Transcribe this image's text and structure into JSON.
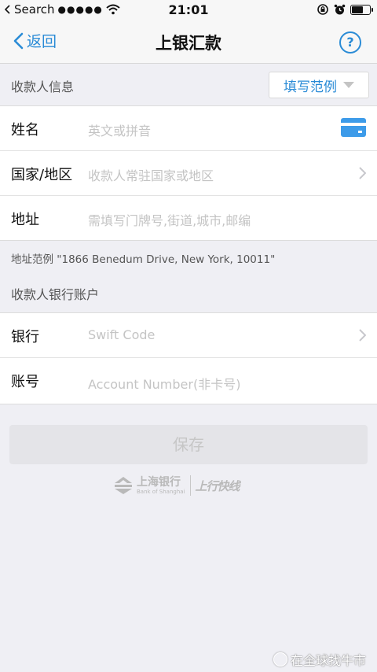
{
  "status_bar": {
    "carrier": "Search",
    "signal": "●●●●●",
    "time": "21:01",
    "battery_level": 0.65
  },
  "nav": {
    "back_label": "返回",
    "title": "上银汇款",
    "help_label": "?"
  },
  "payee_section": {
    "title": "收款人信息",
    "example_button": "填写范例"
  },
  "payee_fields": [
    {
      "label": "姓名",
      "placeholder": "英文或拼音"
    },
    {
      "label": "国家/地区",
      "placeholder": "收款人常驻国家或地区"
    },
    {
      "label": "地址",
      "placeholder": "需填写门牌号,街道,城市,邮编"
    }
  ],
  "address_example": "地址范例 \"1866 Benedum Drive, New York, 10011\"",
  "bank_section": {
    "title": "收款人银行账户"
  },
  "bank_fields": [
    {
      "label": "银行",
      "placeholder": "Swift Code"
    },
    {
      "label": "账号",
      "placeholder": "Account Number(非卡号)"
    }
  ],
  "save_button": "保存",
  "brand": {
    "name_cn": "上海银行",
    "name_en": "Bank of Shanghai",
    "slogan": "上行快线"
  },
  "watermark": "在全球找牛市",
  "colors": {
    "accent": "#2a8bd6",
    "background": "#efeff4",
    "placeholder": "#c4c4c4"
  }
}
